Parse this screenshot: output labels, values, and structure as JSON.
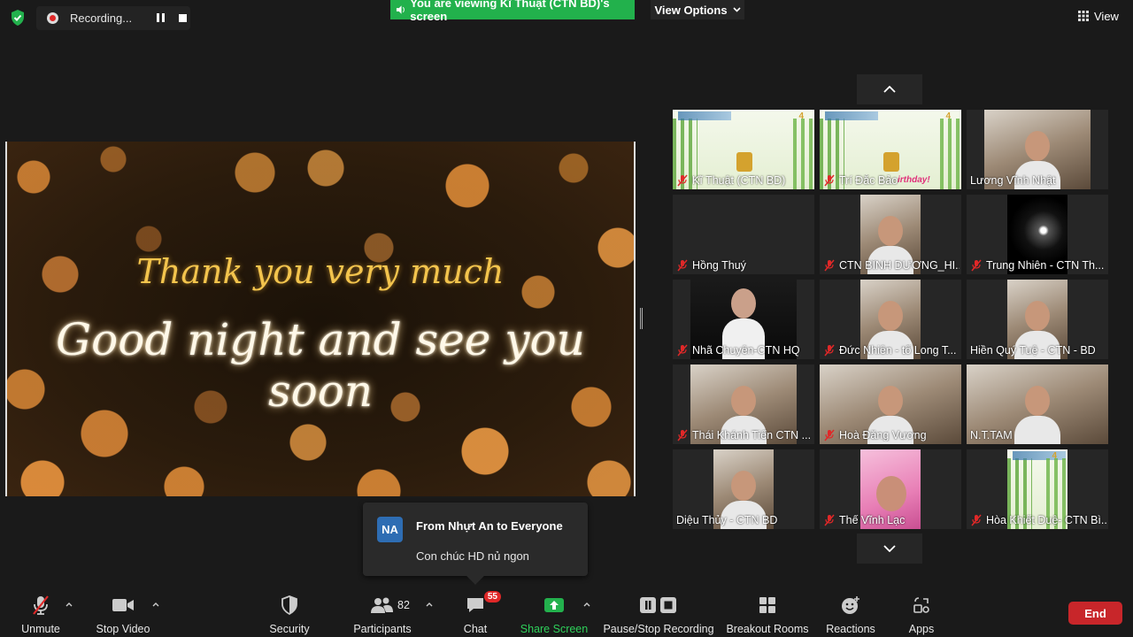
{
  "recording": {
    "text": "Recording..."
  },
  "banner": {
    "viewing_text": "You are viewing Kĩ Thuật (CTN BD)'s screen",
    "view_options": "View Options"
  },
  "view_button": {
    "label": "View"
  },
  "shared_screen": {
    "line1": "Thank you very much",
    "line2": "Good night and see you soon"
  },
  "participants": [
    {
      "name": "Kĩ Thuật (CTN BD)",
      "muted": true
    },
    {
      "name": "Trí Đắc Bảo",
      "muted": true
    },
    {
      "name": "Lương Vĩnh Nhật",
      "muted": false
    },
    {
      "name": "Hồng Thuý",
      "muted": true
    },
    {
      "name": "CTN BÌNH DƯƠNG_HI...",
      "muted": true
    },
    {
      "name": "Trung Nhiên - CTN Th...",
      "muted": true
    },
    {
      "name": "Nhã Chuyên-CTN HQ",
      "muted": true
    },
    {
      "name": "Đức Nhiên - tổ Long T...",
      "muted": true
    },
    {
      "name": "Hiền Quý Tuệ - CTN - BD",
      "muted": false
    },
    {
      "name": "Thái Khánh Tiến CTN ...",
      "muted": true
    },
    {
      "name": "Hoà Đăng Vương",
      "muted": true
    },
    {
      "name": "N.T.TAM",
      "muted": false
    },
    {
      "name": "Diệu Thủy - CTN BD",
      "muted": false
    },
    {
      "name": "Thế Vĩnh Lạc",
      "muted": true
    },
    {
      "name": "Hòa Khiết Duệ- CTN Bì...",
      "muted": true
    }
  ],
  "tile_overlay": {
    "birthday_fragment": "irthday!",
    "logo_number": "4"
  },
  "chat_toast": {
    "avatar": "NA",
    "from": "From Nhựt An to Everyone",
    "message": "Con chúc HD nủ ngon"
  },
  "toolbar": {
    "unmute": "Unmute",
    "stop_video": "Stop Video",
    "security": "Security",
    "participants": "Participants",
    "participants_count": "82",
    "chat": "Chat",
    "chat_badge": "55",
    "share_screen": "Share Screen",
    "pause_stop_recording": "Pause/Stop Recording",
    "breakout_rooms": "Breakout Rooms",
    "reactions": "Reactions",
    "apps": "Apps",
    "end": "End"
  },
  "colors": {
    "accent_green": "#22b14c",
    "end_red": "#c8262a",
    "badge_red": "#e02828",
    "avatar_blue": "#2e6db3"
  }
}
